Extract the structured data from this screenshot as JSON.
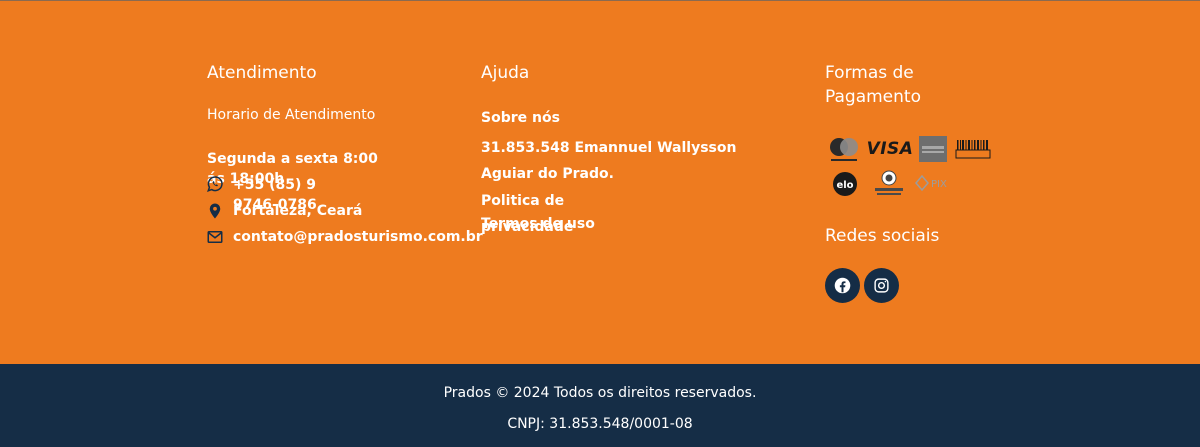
{
  "atendimento": {
    "title": "Atendimento",
    "hours_label": "Horario de Atendimento",
    "hours_value": "Segunda a sexta 8:00 ás 18:00h",
    "phone": "+55 (85) 9 9746-0786",
    "location": "Fortaleza, Ceará",
    "email": "contato@pradosturismo.com.br"
  },
  "ajuda": {
    "title": "Ajuda",
    "links": [
      "Sobre nós",
      "31.853.548 Emannuel Wallysson Aguiar do Prado.",
      "Politica de privacidade",
      "Termos de uso"
    ]
  },
  "pagamento": {
    "title": "Formas de Pagamento",
    "methods": [
      {
        "name": "Mastercard",
        "icon": "mastercard-icon"
      },
      {
        "name": "VISA",
        "icon": "visa-icon"
      },
      {
        "name": "American Express",
        "icon": "amex-icon"
      },
      {
        "name": "Boleto",
        "icon": "boleto-icon"
      },
      {
        "name": "elo",
        "icon": "elo-icon"
      },
      {
        "name": "Diners Club",
        "icon": "diners-icon"
      },
      {
        "name": "PIX",
        "icon": "pix-icon"
      }
    ]
  },
  "redes": {
    "title": "Redes sociais",
    "items": [
      {
        "name": "Facebook",
        "icon": "facebook-icon"
      },
      {
        "name": "Instagram",
        "icon": "instagram-icon"
      }
    ]
  },
  "bottom": {
    "copyright": "Prados © 2024 Todos os direitos reservados.",
    "cnpj": "CNPJ: 31.853.548/0001-08"
  },
  "colors": {
    "orange": "#ee7b1f",
    "navy": "#152d46"
  }
}
